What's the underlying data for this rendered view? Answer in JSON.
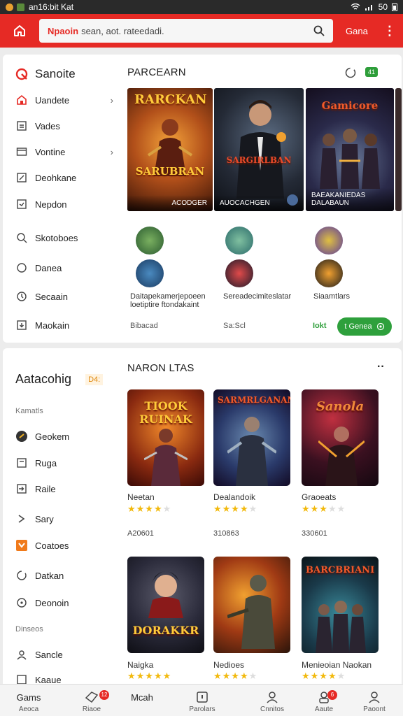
{
  "status_bar": {
    "app_label": "an16:bit Kat",
    "battery": "50"
  },
  "header": {
    "search_brand": "Npaoin",
    "search_placeholder": "sean, aot. rateedadi.",
    "game_link": "Gana"
  },
  "top_card": {
    "sidebar_title": "Sanoite",
    "sidebar_items": [
      {
        "label": "Uandete",
        "icon": "home-icon",
        "chevron": true
      },
      {
        "label": "Vades",
        "icon": "list-icon",
        "chevron": false
      },
      {
        "label": "Vontine",
        "icon": "window-icon",
        "chevron": true
      },
      {
        "label": "Deohkane",
        "icon": "edit-icon",
        "chevron": false
      },
      {
        "label": "Nepdon",
        "icon": "edit-box-icon",
        "chevron": false
      },
      {
        "label": "Skotoboes",
        "icon": "search-icon",
        "chevron": false
      },
      {
        "label": "Danea",
        "icon": "moon-icon",
        "chevron": false
      },
      {
        "label": "Secaain",
        "icon": "clock-icon",
        "chevron": false
      },
      {
        "label": "Maokain",
        "icon": "download-icon",
        "chevron": false
      }
    ],
    "section_title": "PARCEARN",
    "badge_count": "41",
    "banners": [
      {
        "logo": "RARCKAN",
        "sub_logo": "SARUBRAN",
        "caption": "ACODGER"
      },
      {
        "logo": "SARGIRLBAN",
        "sub_logo": "",
        "caption": "AUOCACHGEN"
      },
      {
        "logo": "Gamicore",
        "sub_logo": "",
        "caption": "BAEAKANIEDAS DALABAUN"
      }
    ],
    "mini_games": [
      {
        "title": "Daitapekamerjepoeen loetiptire ftondakaint",
        "sub": "Bibacad"
      },
      {
        "title": "Sereadecimiteslatar",
        "sub": "Sa:Scl"
      },
      {
        "title": "Siaamtlars",
        "sub": ""
      }
    ],
    "text_link": "Iokt",
    "green_button": "t Genea"
  },
  "bottom_card": {
    "sidebar_title": "Aatacohig",
    "sidebar_tag": "D4:",
    "group1_label": "Kamatls",
    "group1_items": [
      {
        "label": "Geokem",
        "icon": "game-dot-icon"
      },
      {
        "label": "Ruga",
        "icon": "box-icon"
      },
      {
        "label": "Raile",
        "icon": "login-icon"
      },
      {
        "label": "Sary",
        "icon": "bolt-icon"
      },
      {
        "label": "Coatoes",
        "icon": "puzzle-icon"
      },
      {
        "label": "Datkan",
        "icon": "refresh-icon"
      },
      {
        "label": "Deonoin",
        "icon": "target-icon"
      }
    ],
    "group2_label": "Dinseos",
    "group2_items": [
      {
        "label": "Sancle",
        "icon": "share-icon"
      },
      {
        "label": "Kaaue",
        "icon": "image-icon"
      }
    ],
    "section_title": "NARON LTAS",
    "tiles": [
      {
        "title": "TIOOK RUINAK",
        "name": "Neetan",
        "stars": 4,
        "count": "A20601"
      },
      {
        "title": "SARMRLGANAN",
        "name": "Dealandoik",
        "stars": 4,
        "count": "310863"
      },
      {
        "title": "Sanola",
        "name": "Graoeats",
        "stars": 3,
        "count": "330601"
      },
      {
        "title": "DORAKKR",
        "name": "Naigka",
        "stars": 5,
        "count": ""
      },
      {
        "title": "",
        "name": "Nedioes",
        "stars": 4,
        "count": ""
      },
      {
        "title": "BARCBRIANI",
        "name": "Menieoian Naokan",
        "stars": 4,
        "count": ""
      }
    ]
  },
  "bottom_nav": [
    {
      "label_top": "Gams",
      "label": "Aeoca",
      "icon": "gamepad-icon",
      "badge": ""
    },
    {
      "label_top": "",
      "label": "Riaoe",
      "icon": "ticket-icon",
      "badge": "12"
    },
    {
      "label_top": "Mcah",
      "label": "",
      "icon": "",
      "badge": ""
    },
    {
      "label_top": "",
      "label": "Parolars",
      "icon": "tv-icon",
      "badge": ""
    },
    {
      "label_top": "",
      "label": "Cnnitos",
      "icon": "user-icon",
      "badge": ""
    },
    {
      "label_top": "",
      "label": "Aaute",
      "icon": "person-badge-icon",
      "badge": "6"
    },
    {
      "label_top": "",
      "label": "Paoont",
      "icon": "profile-icon",
      "badge": ""
    }
  ]
}
